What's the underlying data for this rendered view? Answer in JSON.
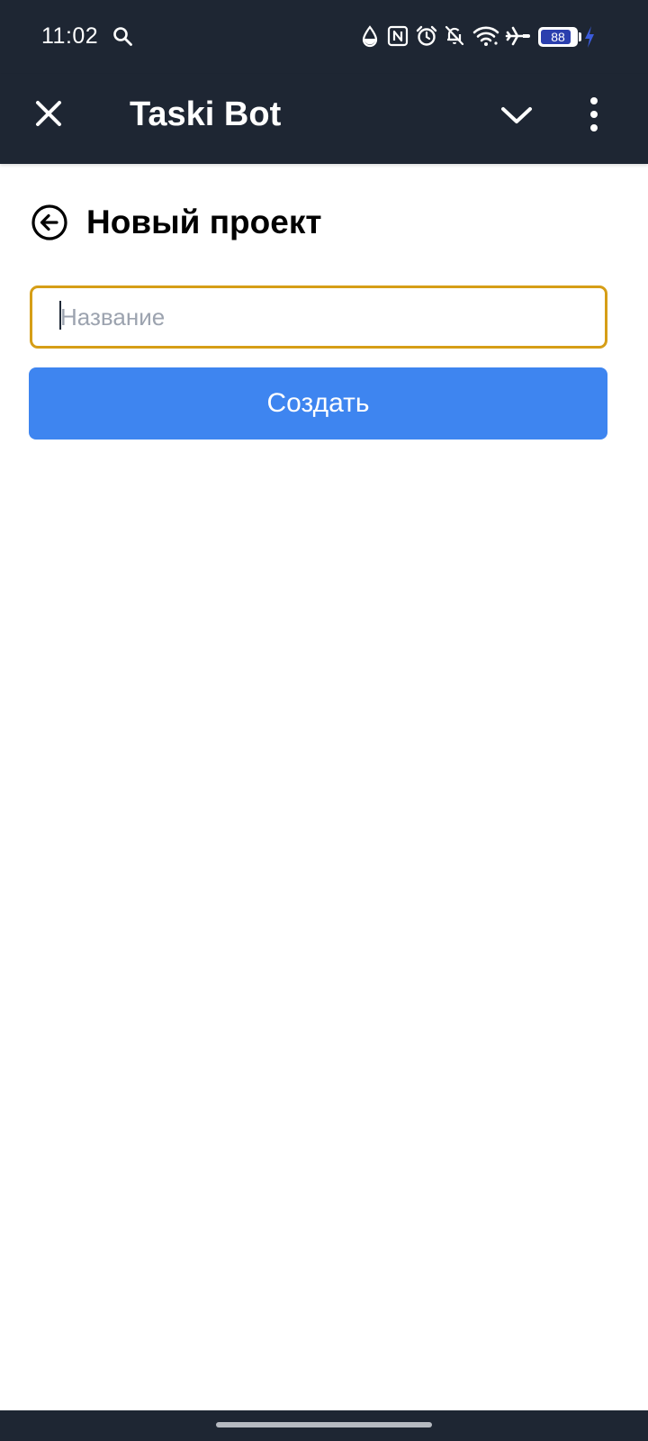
{
  "status_bar": {
    "time": "11:02",
    "battery_percent": "88",
    "battery_level": 0.88,
    "icons": [
      "search-icon",
      "data-saver-icon",
      "nfc-icon",
      "alarm-icon",
      "bell-off-icon",
      "wifi-icon",
      "airplane-icon",
      "battery-icon",
      "charging-icon"
    ]
  },
  "header": {
    "title": "Taski Bot",
    "icons": [
      "close-icon",
      "chevron-down-icon",
      "more-vertical-icon"
    ]
  },
  "page": {
    "title": "Новый проект",
    "back_icon": "arrow-left-circle-icon",
    "name_input": {
      "value": "",
      "placeholder": "Название"
    },
    "create_button": "Создать"
  },
  "colors": {
    "bar_background": "#1e2633",
    "input_border": "#d69e17",
    "button_blue": "#3e85f0",
    "battery_fill": "#2b3fae",
    "charging_bolt": "#3b5bdb"
  }
}
